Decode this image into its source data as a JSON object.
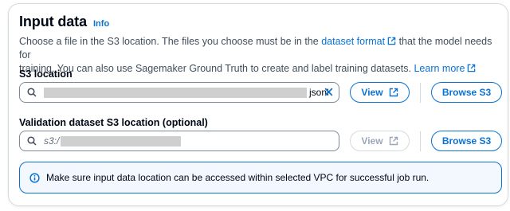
{
  "header": {
    "title": "Input data",
    "info_label": "Info"
  },
  "description": {
    "text_1": "Choose a file in the S3 location. The files you choose must be in the",
    "dataset_format_link": "dataset format",
    "text_2": "that the model needs for",
    "text_3": "training. You can also use Sagemaker Ground Truth to create and label training datasets.",
    "learn_more_link": "Learn more"
  },
  "s3_location": {
    "label": "S3 location",
    "value_suffix": "jsonl",
    "view_label": "View",
    "browse_label": "Browse S3"
  },
  "validation_location": {
    "label": "Validation dataset S3 location (optional)",
    "value_prefix": "s3:/",
    "view_label": "View",
    "browse_label": "Browse S3"
  },
  "alert": {
    "text": "Make sure input data location can be accessed within selected VPC for successful job run."
  },
  "colors": {
    "accent": "#0972d3",
    "border": "#7d8998",
    "disabled": "#9ba7b6",
    "info_bg": "#f2f8fd"
  },
  "icons": [
    "search-icon",
    "external-link-icon",
    "clear-icon",
    "info-circle-icon"
  ]
}
